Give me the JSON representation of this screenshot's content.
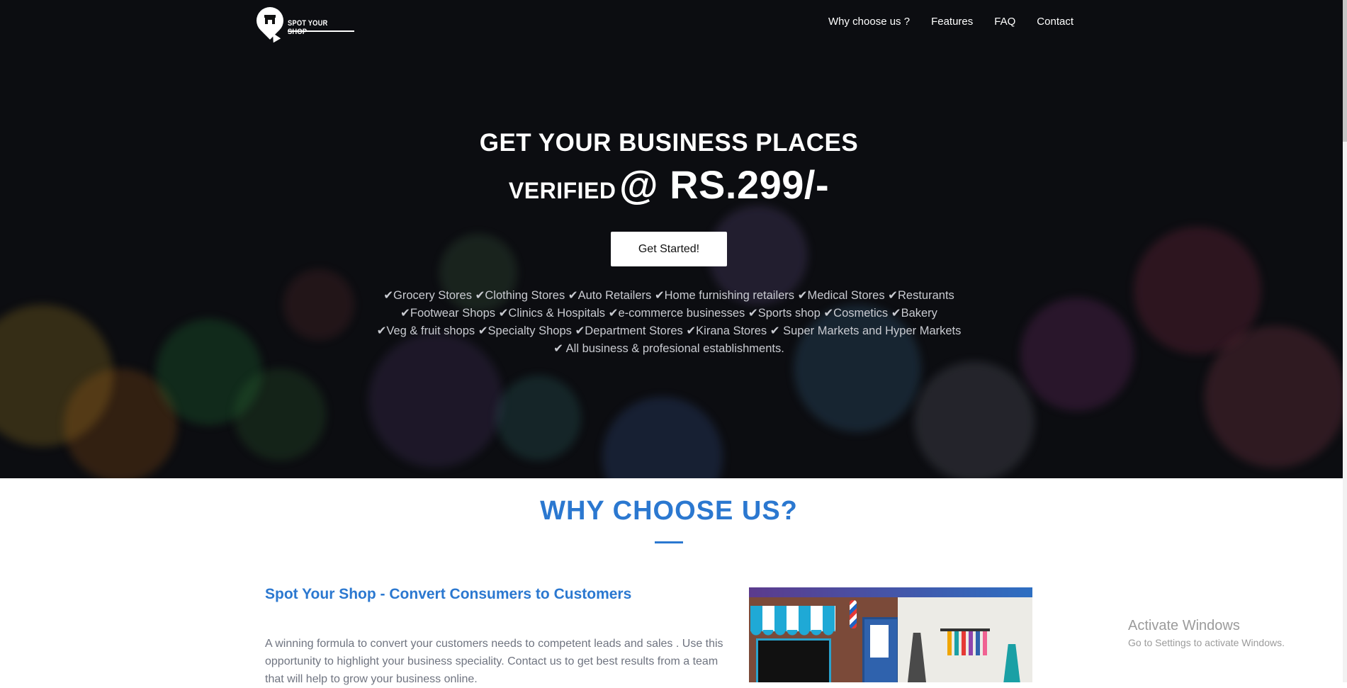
{
  "nav": {
    "logo_text": "SPOT YOUR SHOP",
    "links": [
      "Why choose us ?",
      "Features",
      "FAQ",
      "Contact"
    ]
  },
  "hero": {
    "title_line1": "GET YOUR BUSINESS PLACES",
    "title_verified": "VERIFIED",
    "title_price": "@ RS.299/-",
    "cta_label": "Get Started!",
    "business_lines": [
      "✔Grocery Stores ✔Clothing Stores ✔Auto Retailers ✔Home furnishing retailers ✔Medical Stores ✔Resturants",
      "✔Footwear Shops ✔Clinics & Hospitals ✔e-commerce businesses ✔Sports shop ✔Cosmetics ✔Bakery",
      "✔Veg & fruit shops ✔Specialty Shops ✔Department Stores ✔Kirana Stores ✔ Super Markets and Hyper Markets",
      "✔ All business & profesional establishments."
    ]
  },
  "why": {
    "title": "WHY CHOOSE US?",
    "subtitle": "Spot Your Shop - Convert Consumers to Customers",
    "text": "A winning formula to convert your customers needs to competent leads and sales . Use this opportunity to highlight your business speciality. Contact us to get best results from a team that will help to grow your business online."
  },
  "windows_watermark": {
    "line1": "Activate Windows",
    "line2": "Go to Settings to activate Windows."
  },
  "colors": {
    "accent": "#2b78d0",
    "hero_bg": "#0c0d11"
  }
}
